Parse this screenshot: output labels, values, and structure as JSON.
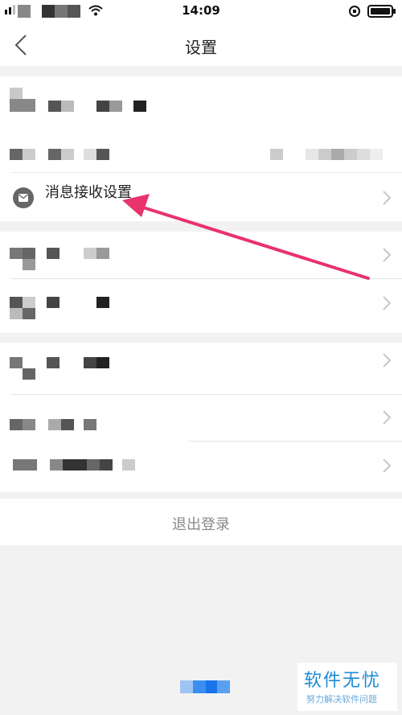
{
  "status_bar": {
    "time": "14:09"
  },
  "header": {
    "title": "设置",
    "back_icon": "chevron-left-icon"
  },
  "rows": {
    "message_settings": {
      "label": "消息接收设置",
      "icon": "envelope-icon"
    }
  },
  "logout": {
    "label": "退出登录"
  },
  "watermark": {
    "title": "软件无忧",
    "subtitle": "努力解决软件问题"
  },
  "colors": {
    "arrow": "#e8336c",
    "watermark": "#1b8ad6"
  }
}
